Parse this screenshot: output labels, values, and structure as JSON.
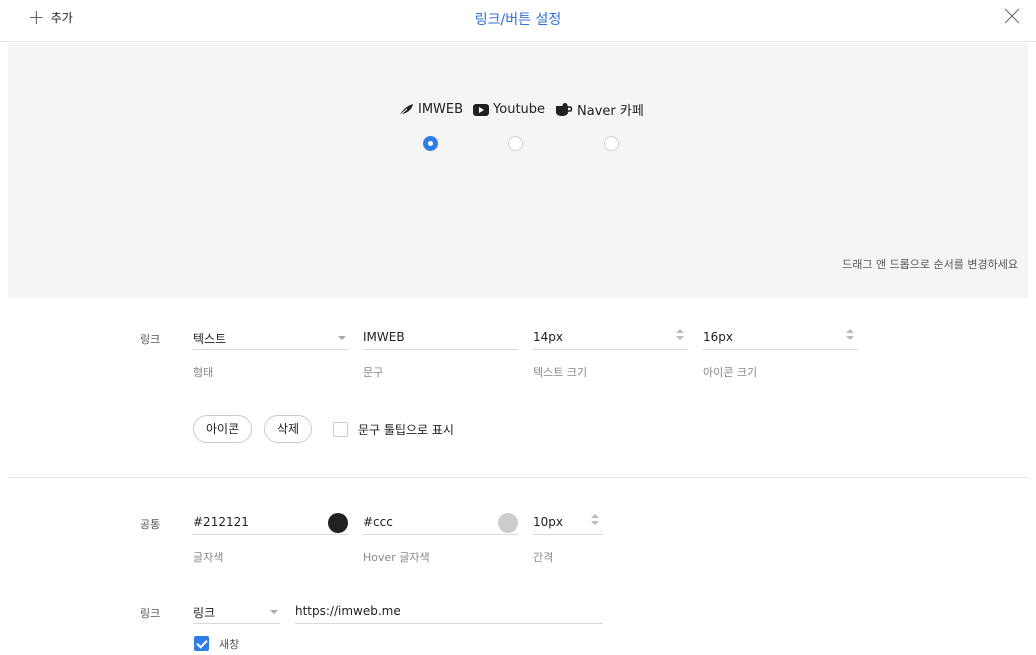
{
  "header": {
    "add_label": "추가",
    "title": "링크/버튼 설정"
  },
  "preview": {
    "links": [
      {
        "icon": "feather-icon",
        "label": "IMWEB",
        "selected": true
      },
      {
        "icon": "youtube-icon",
        "label": "Youtube",
        "selected": false
      },
      {
        "icon": "naver-cafe-icon",
        "label": "Naver 카페",
        "selected": false
      }
    ],
    "hint": "드래그 앤 드롭으로 순서를 변경하세요"
  },
  "link_settings": {
    "row_label": "링크",
    "type": {
      "value": "텍스트",
      "label": "형태"
    },
    "text": {
      "value": "IMWEB",
      "label": "문구"
    },
    "text_size": {
      "value": "14px",
      "label": "텍스트 크기"
    },
    "icon_size": {
      "value": "16px",
      "label": "아이콘 크기"
    },
    "icon_button": "아이콘",
    "delete_button": "삭제",
    "tooltip_label": "문구 툴팁으로 표시",
    "tooltip_checked": false
  },
  "common_settings": {
    "row_label": "공통",
    "text_color": {
      "value": "#212121",
      "label": "글자색",
      "swatch": "#212121"
    },
    "hover_color": {
      "value": "#ccc",
      "label": "Hover 글자색",
      "swatch": "#cccccc"
    },
    "spacing": {
      "value": "10px",
      "label": "간격"
    }
  },
  "link_target": {
    "row_label": "링크",
    "type": "링크",
    "url": "https://imweb.me",
    "new_window_label": "새창",
    "new_window_checked": true
  },
  "colors": {
    "accent": "#2f7ee8",
    "title": "#2f6fdb",
    "preview_bg": "#f5f5f5"
  }
}
